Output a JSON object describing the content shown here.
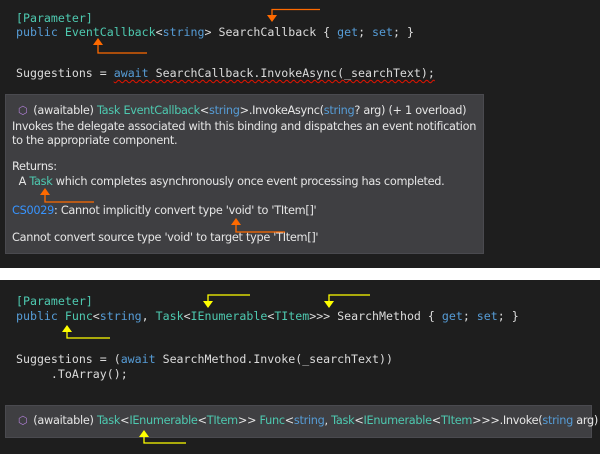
{
  "top": {
    "code": {
      "attribute": "[Parameter]",
      "decl": {
        "kw": "public",
        "type": "EventCallback",
        "lt": "<",
        "generic": "string",
        "gt": ">",
        "name": " SearchCallback { ",
        "get": "get",
        "semi1": "; ",
        "set": "set",
        "end": "; }"
      },
      "stmt": {
        "lhs": "Suggestions = ",
        "await": "await",
        "rest": " SearchCallback.InvokeAsync(_searchText);"
      }
    },
    "tooltip": {
      "icon": "method-cube-icon",
      "sig": {
        "prefix": "(awaitable) ",
        "task": "Task",
        "sp": " ",
        "ec": "EventCallback",
        "lt": "<",
        "str": "string",
        "gt": ">.InvokeAsync(",
        "str2": "string",
        "rest": "? arg) (+ 1 overload)"
      },
      "desc1": "Invokes the delegate associated with this binding and dispatches an event notification",
      "desc2": "to the appropriate component.",
      "returns_label": "Returns:",
      "returns": {
        "pre": "  A ",
        "task": "Task",
        "rest": " which completes asynchronously once event processing has completed."
      },
      "error": {
        "code": "CS0029",
        "msg": ": Cannot implicitly convert type 'void' to 'TItem[]'"
      },
      "error2": "Cannot convert source type 'void' to target type 'TItem[]'"
    },
    "annotation_color": "#ff6a00"
  },
  "bottom": {
    "code": {
      "attribute": "[Parameter]",
      "decl": {
        "kw": "public",
        "func": "Func",
        "lt": "<",
        "str": "string",
        "comma": ", ",
        "task": "Task",
        "lt2": "<",
        "ienum": "IEnumerable",
        "lt3": "<",
        "titem": "TItem",
        "gts": ">>>",
        "name": " SearchMethod { ",
        "get": "get",
        "semi1": "; ",
        "set": "set",
        "end": "; }"
      },
      "stmt1": {
        "lhs": "Suggestions = (",
        "await": "await",
        "rest": " SearchMethod.Invoke(_searchText))"
      },
      "stmt2": "     .ToArray();"
    },
    "tooltip": {
      "icon": "method-cube-icon",
      "prefix": "(awaitable) ",
      "t1": "Task",
      "l1": "<",
      "t2": "IEnumerable",
      "l2": "<",
      "t3": "TItem",
      "g1": ">> ",
      "t4": "Func",
      "l3": "<",
      "s1": "string",
      "c1": ", ",
      "t5": "Task",
      "l4": "<",
      "t6": "IEnumerable",
      "l5": "<",
      "t7": "TItem",
      "g2": ">>>.Invoke(",
      "s2": "string",
      "end": " arg)"
    },
    "annotation_color": "#ffff00"
  }
}
